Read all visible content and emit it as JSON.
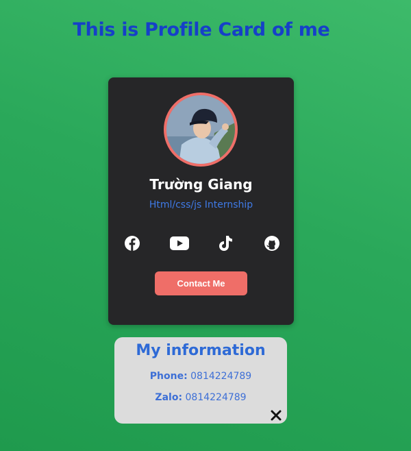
{
  "page": {
    "title": "This is Profile Card of me"
  },
  "profile": {
    "name": "Trường Giang",
    "role": "Html/css/js Internship",
    "socials": [
      {
        "icon": "facebook-icon"
      },
      {
        "icon": "youtube-icon"
      },
      {
        "icon": "tiktok-icon"
      },
      {
        "icon": "github-icon"
      }
    ],
    "contact_label": "Contact Me"
  },
  "info": {
    "title": "My information",
    "phone_label": "Phone:",
    "phone_value": "0814224789",
    "zalo_label": "Zalo:",
    "zalo_value": "0814224789",
    "close_icon": "close-icon"
  },
  "colors": {
    "background": "#2aa85a",
    "title": "#1640c8",
    "card": "#262628",
    "accent": "#ef6e68",
    "role": "#3f7ae6",
    "info_bg": "#dcdcdc",
    "info_text": "#3d6fd6"
  }
}
